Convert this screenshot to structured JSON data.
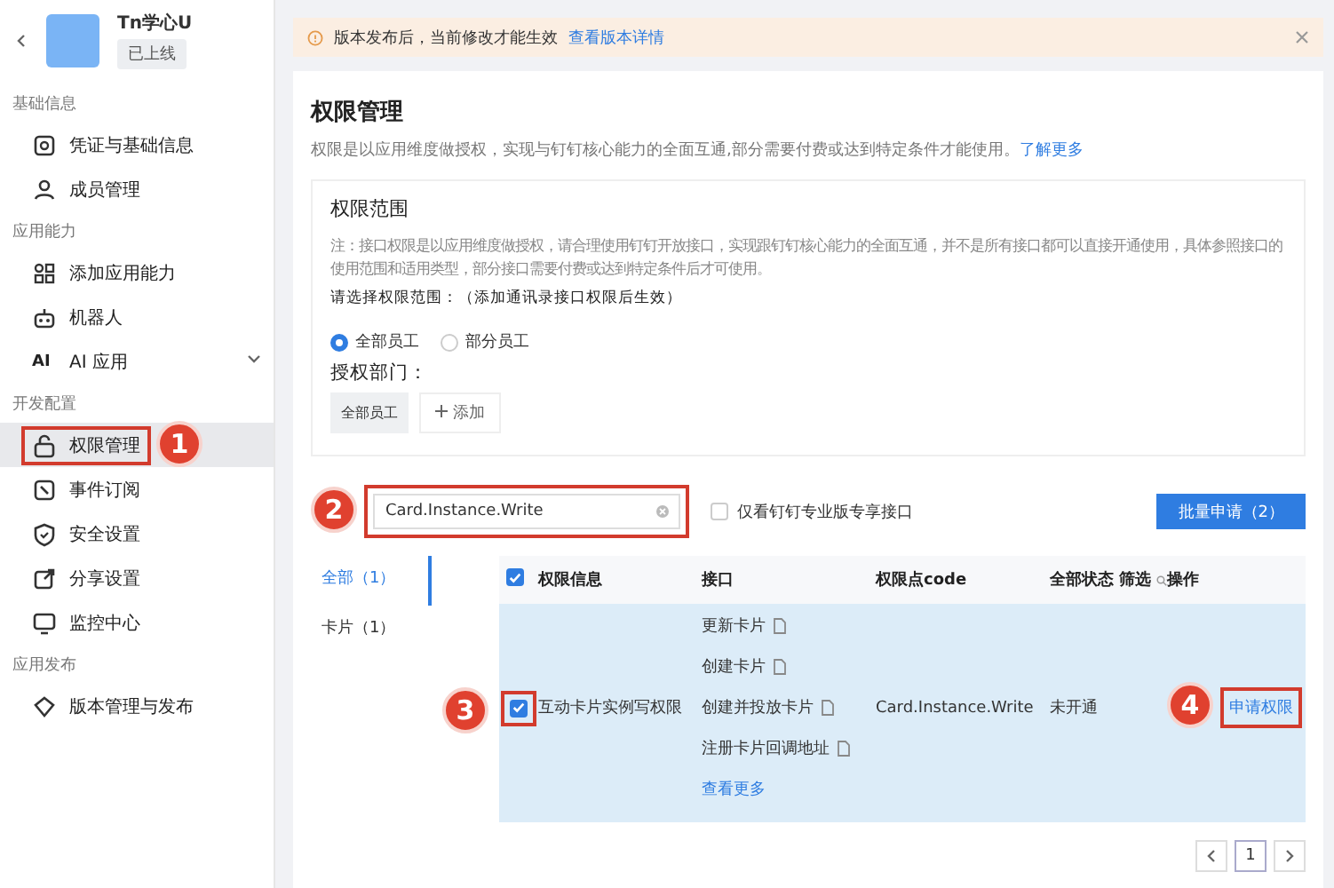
{
  "app": {
    "name": "Tn学心U",
    "status": "已上线"
  },
  "sidebar": {
    "sections": [
      {
        "title": "基础信息",
        "items": [
          {
            "label": "凭证与基础信息",
            "kind": "credential",
            "selected": false
          },
          {
            "label": "成员管理",
            "kind": "person",
            "selected": false
          }
        ]
      },
      {
        "title": "应用能力",
        "items": [
          {
            "label": "添加应用能力",
            "kind": "grid",
            "selected": false
          },
          {
            "label": "机器人",
            "kind": "robot",
            "selected": false
          },
          {
            "label": "AI 应用",
            "kind": "ai",
            "badge": "AI",
            "selected": false,
            "expanded": false
          }
        ]
      },
      {
        "title": "开发配置",
        "items": [
          {
            "label": "权限管理",
            "kind": "lock",
            "selected": true,
            "highlighted": true,
            "marker": "1"
          },
          {
            "label": "事件订阅",
            "kind": "event",
            "selected": false
          },
          {
            "label": "安全设置",
            "kind": "shield",
            "selected": false
          },
          {
            "label": "分享设置",
            "kind": "share",
            "selected": false
          },
          {
            "label": "监控中心",
            "kind": "monitor",
            "selected": false
          }
        ]
      },
      {
        "title": "应用发布",
        "items": [
          {
            "label": "版本管理与发布",
            "kind": "version",
            "selected": false
          }
        ]
      }
    ]
  },
  "banner": {
    "text": "版本发布后，当前修改才能生效",
    "link": "查看版本详情"
  },
  "page": {
    "title": "权限管理",
    "description": "权限是以应用维度做授权，实现与钉钉核心能力的全面互通,部分需要付费或达到特定条件才能使用。",
    "link": "了解更多"
  },
  "scope": {
    "title": "权限范围",
    "note": "注：接口权限是以应用维度做授权，请合理使用钉钉开放接口，实现跟钉钉核心能力的全面互通，并不是所有接口都可以直接开通使用，具体参照接口的使用范围和适用类型，部分接口需要付费或达到特定条件后才可使用。",
    "prompt": "请选择权限范围：（添加通讯录接口权限后生效）",
    "options": [
      {
        "label": "全部员工",
        "selected": true
      },
      {
        "label": "部分员工",
        "selected": false
      }
    ],
    "dept_label": "授权部门：",
    "depts": [
      "全部员工"
    ],
    "add_button": "添加"
  },
  "search": {
    "value": "Card.Instance.Write",
    "highlighted": true,
    "marker": "2"
  },
  "filter": {
    "label": "仅看钉钉专业版专享接口",
    "checked": false
  },
  "batch_button": "批量申请（2）",
  "categories": [
    {
      "label": "全部（1）",
      "selected": true
    },
    {
      "label": "卡片（1）",
      "selected": false
    }
  ],
  "table": {
    "select_all_checked": true,
    "columns": [
      "权限信息",
      "接口",
      "权限点code",
      "全部状态",
      "操作"
    ],
    "filter_label": "筛选",
    "rows": [
      {
        "checked": true,
        "selected": true,
        "checkbox_highlighted": true,
        "checkbox_marker": "3",
        "name": "互动卡片实例写权限",
        "apis": [
          "更新卡片",
          "创建卡片",
          "创建并投放卡片",
          "注册卡片回调地址"
        ],
        "more": "查看更多",
        "code": "Card.Instance.Write",
        "status": "未开通",
        "action": "申请权限",
        "action_highlighted": true,
        "action_marker": "4"
      }
    ]
  },
  "pagination": {
    "pages": [
      {
        "label": "1",
        "selected": true
      }
    ]
  }
}
